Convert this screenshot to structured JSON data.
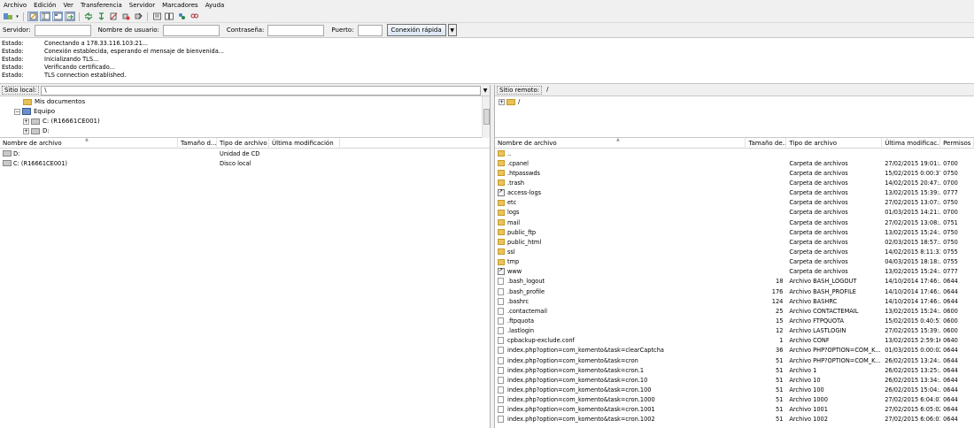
{
  "menu": [
    "Archivo",
    "Edición",
    "Ver",
    "Transferencia",
    "Servidor",
    "Marcadores",
    "Ayuda"
  ],
  "quickconnect": {
    "server_label": "Servidor:",
    "user_label": "Nombre de usuario:",
    "password_label": "Contraseña:",
    "port_label": "Puerto:",
    "server_value": "",
    "user_value": "",
    "password_value": "",
    "port_value": "",
    "connect_button": "Conexión rápida",
    "dropdown_icon": "▼"
  },
  "log": [
    {
      "key": "Estado:",
      "msg": "Conectando a 178.33.116.103:21..."
    },
    {
      "key": "Estado:",
      "msg": "Conexión establecida, esperando el mensaje de bienvenida..."
    },
    {
      "key": "Estado:",
      "msg": "Inicializando TLS..."
    },
    {
      "key": "Estado:",
      "msg": "Verificando certificado..."
    },
    {
      "key": "Estado:",
      "msg": "TLS connection established."
    }
  ],
  "local": {
    "site_label": "Sitio local:",
    "path": "\\",
    "tree": [
      {
        "label": "Mis documentos",
        "icon": "folder-icon"
      },
      {
        "label": "Equipo",
        "icon": "computer-icon",
        "expander": "⊟"
      },
      {
        "label": "C: (R16661CE001)",
        "icon": "drive-icon",
        "expander": "⊞"
      },
      {
        "label": "D:",
        "icon": "drive-icon",
        "expander": "⊞"
      }
    ],
    "columns": [
      "Nombre de archivo",
      "Tamaño d...",
      "Tipo de archivo",
      "Última modificación"
    ],
    "files": [
      {
        "name": "D:",
        "type": "Unidad de CD"
      },
      {
        "name": "C: (R16661CE001)",
        "type": "Disco local"
      }
    ]
  },
  "remote": {
    "site_label": "Sitio remoto:",
    "path": "/",
    "tree": [
      {
        "label": "/",
        "expander": "⊞"
      }
    ],
    "columns": [
      "Nombre de archivo",
      "Tamaño de...",
      "Tipo de archivo",
      "Última modificac...",
      "Permisos"
    ],
    "files": [
      {
        "name": "..",
        "size": "",
        "type": "",
        "modified": "",
        "perms": "",
        "icon": "up"
      },
      {
        "name": ".cpanel",
        "size": "",
        "type": "Carpeta de archivos",
        "modified": "27/02/2015 19:01:...",
        "perms": "0700",
        "icon": "folder"
      },
      {
        "name": ".htpasswds",
        "size": "",
        "type": "Carpeta de archivos",
        "modified": "15/02/2015 0:00:37",
        "perms": "0750",
        "icon": "folder"
      },
      {
        "name": ".trash",
        "size": "",
        "type": "Carpeta de archivos",
        "modified": "14/02/2015 20:47:...",
        "perms": "0700",
        "icon": "folder"
      },
      {
        "name": "access-logs",
        "size": "",
        "type": "Carpeta de archivos",
        "modified": "13/02/2015 15:39:...",
        "perms": "0777",
        "icon": "link"
      },
      {
        "name": "etc",
        "size": "",
        "type": "Carpeta de archivos",
        "modified": "27/02/2015 13:07:...",
        "perms": "0750",
        "icon": "folder"
      },
      {
        "name": "logs",
        "size": "",
        "type": "Carpeta de archivos",
        "modified": "01/03/2015 14:21:...",
        "perms": "0700",
        "icon": "folder"
      },
      {
        "name": "mail",
        "size": "",
        "type": "Carpeta de archivos",
        "modified": "27/02/2015 13:08:...",
        "perms": "0751",
        "icon": "folder"
      },
      {
        "name": "public_ftp",
        "size": "",
        "type": "Carpeta de archivos",
        "modified": "13/02/2015 15:24:...",
        "perms": "0750",
        "icon": "folder"
      },
      {
        "name": "public_html",
        "size": "",
        "type": "Carpeta de archivos",
        "modified": "02/03/2015 18:57:...",
        "perms": "0750",
        "icon": "folder"
      },
      {
        "name": "ssl",
        "size": "",
        "type": "Carpeta de archivos",
        "modified": "14/02/2015 8:11:33",
        "perms": "0755",
        "icon": "folder"
      },
      {
        "name": "tmp",
        "size": "",
        "type": "Carpeta de archivos",
        "modified": "04/03/2015 18:18:...",
        "perms": "0755",
        "icon": "folder"
      },
      {
        "name": "www",
        "size": "",
        "type": "Carpeta de archivos",
        "modified": "13/02/2015 15:24:...",
        "perms": "0777",
        "icon": "link"
      },
      {
        "name": ".bash_logout",
        "size": "18",
        "type": "Archivo BASH_LOGOUT",
        "modified": "14/10/2014 17:46:...",
        "perms": "0644",
        "icon": "file"
      },
      {
        "name": ".bash_profile",
        "size": "176",
        "type": "Archivo BASH_PROFILE",
        "modified": "14/10/2014 17:46:...",
        "perms": "0644",
        "icon": "file"
      },
      {
        "name": ".bashrc",
        "size": "124",
        "type": "Archivo BASHRC",
        "modified": "14/10/2014 17:46:...",
        "perms": "0644",
        "icon": "file"
      },
      {
        "name": ".contactemail",
        "size": "25",
        "type": "Archivo CONTACTEMAIL",
        "modified": "13/02/2015 15:24:...",
        "perms": "0600",
        "icon": "file"
      },
      {
        "name": ".ftpquota",
        "size": "15",
        "type": "Archivo FTPQUOTA",
        "modified": "15/02/2015 0:40:51",
        "perms": "0600",
        "icon": "file"
      },
      {
        "name": ".lastlogin",
        "size": "12",
        "type": "Archivo LASTLOGIN",
        "modified": "27/02/2015 15:39:...",
        "perms": "0600",
        "icon": "file"
      },
      {
        "name": "cpbackup-exclude.conf",
        "size": "1",
        "type": "Archivo CONF",
        "modified": "13/02/2015 2:59:16",
        "perms": "0640",
        "icon": "file"
      },
      {
        "name": "index.php?option=com_komento&task=clearCaptcha",
        "size": "36",
        "type": "Archivo PHP?OPTION=COM_K...",
        "modified": "01/03/2015 0:00:02",
        "perms": "0644",
        "icon": "file"
      },
      {
        "name": "index.php?option=com_komento&task=cron",
        "size": "51",
        "type": "Archivo PHP?OPTION=COM_K...",
        "modified": "26/02/2015 13:24:...",
        "perms": "0644",
        "icon": "file"
      },
      {
        "name": "index.php?option=com_komento&task=cron.1",
        "size": "51",
        "type": "Archivo 1",
        "modified": "26/02/2015 13:25:...",
        "perms": "0644",
        "icon": "file"
      },
      {
        "name": "index.php?option=com_komento&task=cron.10",
        "size": "51",
        "type": "Archivo 10",
        "modified": "26/02/2015 13:34:...",
        "perms": "0644",
        "icon": "file"
      },
      {
        "name": "index.php?option=com_komento&task=cron.100",
        "size": "51",
        "type": "Archivo 100",
        "modified": "26/02/2015 15:04:...",
        "perms": "0644",
        "icon": "file"
      },
      {
        "name": "index.php?option=com_komento&task=cron.1000",
        "size": "51",
        "type": "Archivo 1000",
        "modified": "27/02/2015 6:04:01",
        "perms": "0644",
        "icon": "file"
      },
      {
        "name": "index.php?option=com_komento&task=cron.1001",
        "size": "51",
        "type": "Archivo 1001",
        "modified": "27/02/2015 6:05:02",
        "perms": "0644",
        "icon": "file"
      },
      {
        "name": "index.php?option=com_komento&task=cron.1002",
        "size": "51",
        "type": "Archivo 1002",
        "modified": "27/02/2015 6:06:01",
        "perms": "0644",
        "icon": "file"
      }
    ]
  }
}
